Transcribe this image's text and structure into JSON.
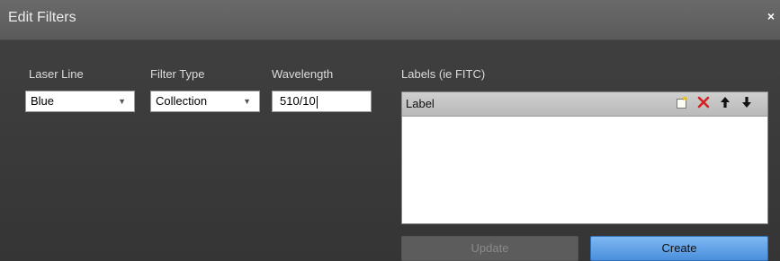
{
  "dialog": {
    "title": "Edit Filters",
    "close_glyph": "×"
  },
  "fields": {
    "laser_line": {
      "label": "Laser Line",
      "value": "Blue"
    },
    "filter_type": {
      "label": "Filter Type",
      "value": "Collection"
    },
    "wavelength": {
      "label": "Wavelength",
      "value": "510/10"
    }
  },
  "labels_panel": {
    "heading": "Labels (ie FITC)",
    "column_header": "Label",
    "toolbar_icons": [
      "new-item-icon",
      "delete-x-icon",
      "move-up-icon",
      "move-down-icon"
    ],
    "rows": []
  },
  "buttons": {
    "update": "Update",
    "create": "Create"
  },
  "colors": {
    "accent": "#4a8fdc",
    "delete": "#d42020",
    "background": "#3c3c3c"
  }
}
